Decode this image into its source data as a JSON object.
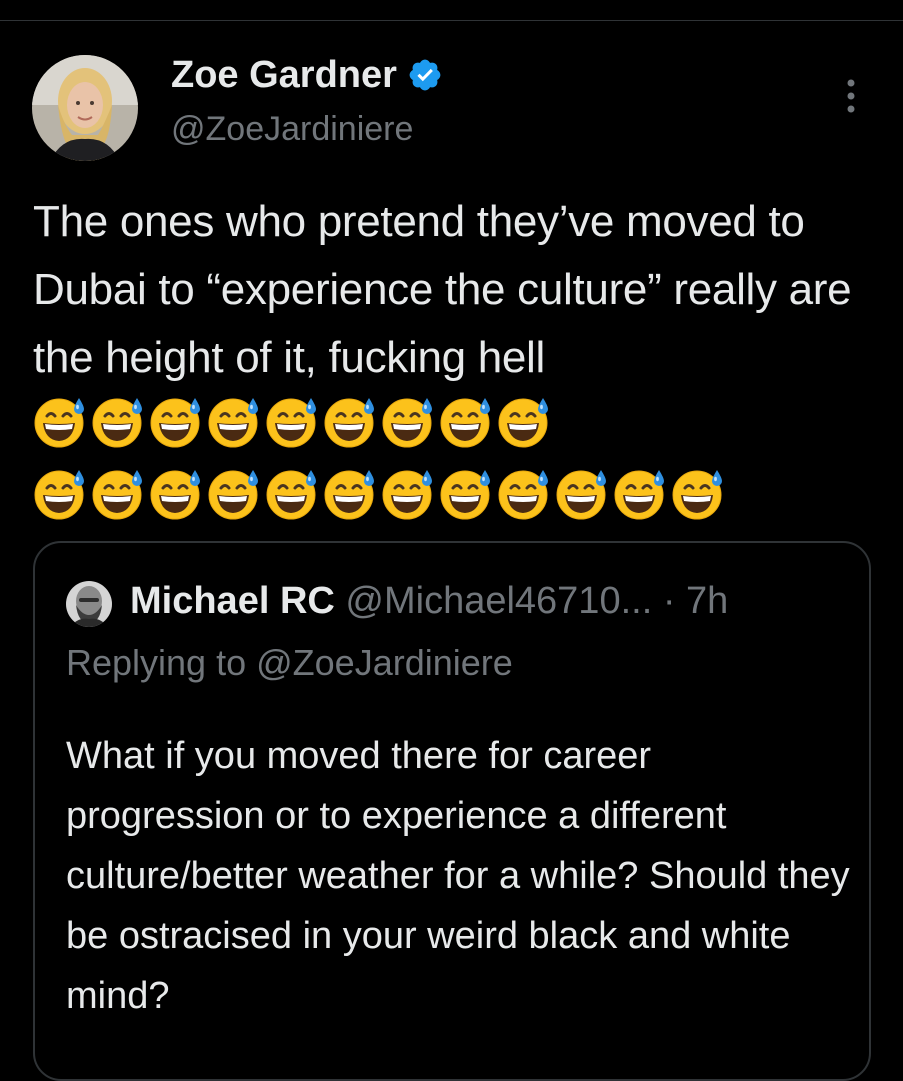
{
  "tweet": {
    "author_name": "Zoe Gardner",
    "author_handle": "@ZoeJardiniere",
    "text": "The ones who pretend they’ve moved to Dubai to “experience the culture” really are the height of it, fucking hell",
    "emoji_line1_count": 9,
    "emoji_line2_count": 12,
    "emoji_name": "grinning-face-with-sweat"
  },
  "quote": {
    "author_name": "Michael RC",
    "author_handle": "@Michael46710...",
    "separator": "·",
    "time": "7h",
    "replying_prefix": "Replying to",
    "replying_handle": "@ZoeJardiniere",
    "text": "What if you moved there for career progression or to experience a different culture/better weather for a while? Should they be ostracised in your weird black and white mind?"
  },
  "colors": {
    "background": "#000000",
    "primary_text": "#e7e9ea",
    "secondary_text": "#71767b",
    "border": "#2f3336",
    "verified": "#1d9bf0"
  }
}
